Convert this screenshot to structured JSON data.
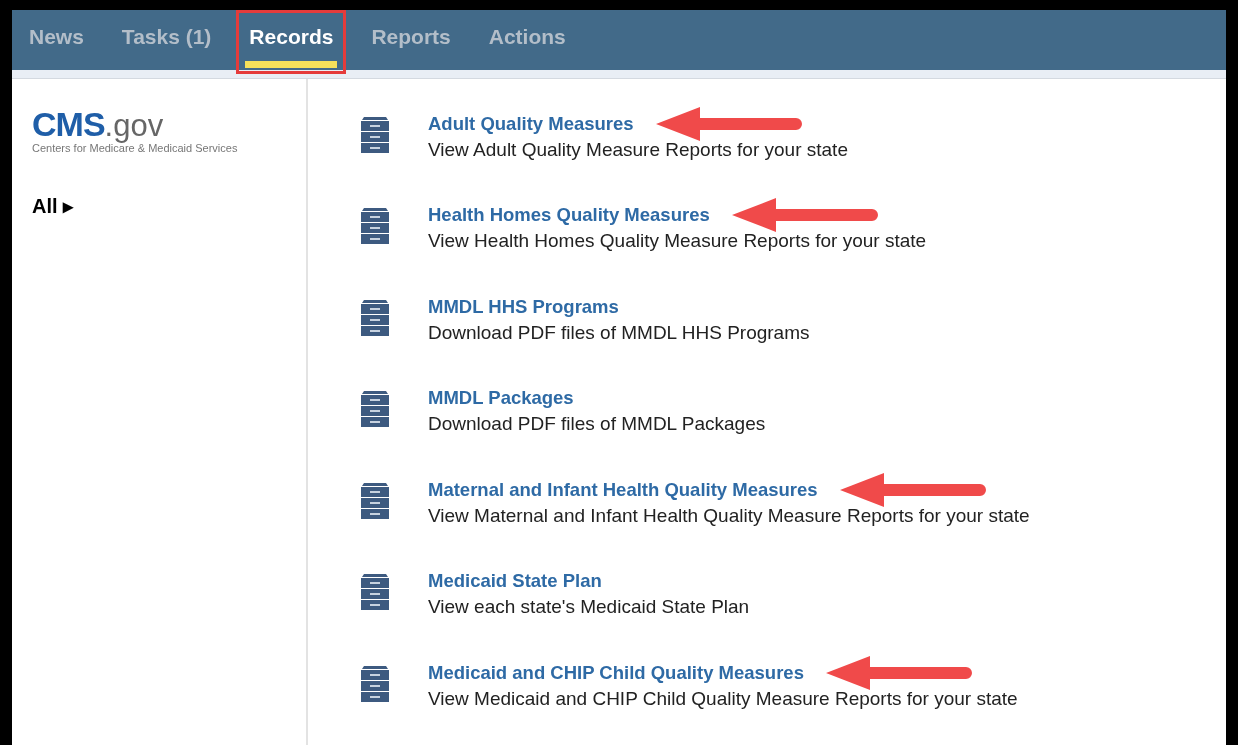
{
  "tabs": [
    {
      "label": "News",
      "selected": false,
      "highlighted": false
    },
    {
      "label": "Tasks (1)",
      "selected": false,
      "highlighted": false
    },
    {
      "label": "Records",
      "selected": true,
      "highlighted": true
    },
    {
      "label": "Reports",
      "selected": false,
      "highlighted": false
    },
    {
      "label": "Actions",
      "selected": false,
      "highlighted": false
    }
  ],
  "sidebar": {
    "logo": {
      "brand": "CMS",
      "suffix": ".gov",
      "tagline": "Centers for Medicare & Medicaid Services"
    },
    "filter": {
      "label": "All",
      "marker": "▸"
    }
  },
  "records": [
    {
      "title": "Adult Quality Measures",
      "description": "View Adult Quality Measure Reports for your state",
      "arrow": true
    },
    {
      "title": "Health Homes Quality Measures",
      "description": "View Health Homes Quality Measure Reports for your state",
      "arrow": true
    },
    {
      "title": "MMDL HHS Programs",
      "description": "Download PDF files of MMDL HHS Programs",
      "arrow": false
    },
    {
      "title": "MMDL Packages",
      "description": "Download PDF files of MMDL Packages",
      "arrow": false
    },
    {
      "title": "Maternal and Infant Health Quality Measures",
      "description": "View Maternal and Infant Health Quality Measure Reports for your state",
      "arrow": true
    },
    {
      "title": "Medicaid State Plan",
      "description": "View each state's Medicaid State Plan",
      "arrow": false
    },
    {
      "title": "Medicaid and CHIP Child Quality Measures",
      "description": "View Medicaid and CHIP Child Quality Measure Reports for your state",
      "arrow": true
    }
  ]
}
